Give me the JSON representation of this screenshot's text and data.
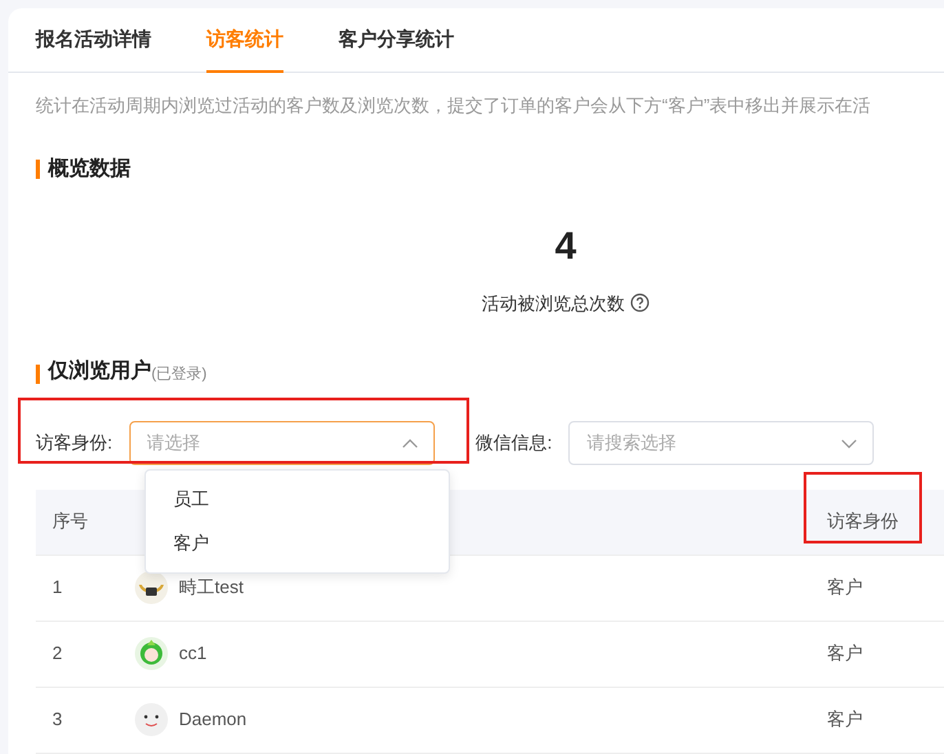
{
  "tabs": [
    {
      "label": "报名活动详情",
      "selected": false
    },
    {
      "label": "访客统计",
      "selected": true
    },
    {
      "label": "客户分享统计",
      "selected": false
    }
  ],
  "description": "统计在活动周期内浏览过活动的客户数及浏览次数，提交了订单的客户会从下方“客户”表中移出并展示在活",
  "overview": {
    "title": "概览数据",
    "value": "4",
    "label": "活动被浏览总次数"
  },
  "users_section": {
    "title": "仅浏览用户",
    "note": "(已登录)"
  },
  "filters": [
    {
      "label": "访客身份:",
      "placeholder": "请选择",
      "expanded": true
    },
    {
      "label": "微信信息:",
      "placeholder": "请搜索选择",
      "expanded": false
    }
  ],
  "dropdown_options": [
    "员工",
    "客户"
  ],
  "table": {
    "columns": [
      "序号",
      "访客身份"
    ],
    "rows": [
      {
        "index": "1",
        "name": "畤工test",
        "identity": "客户"
      },
      {
        "index": "2",
        "name": "cc1",
        "identity": "客户"
      },
      {
        "index": "3",
        "name": "Daemon",
        "identity": "客户"
      }
    ]
  }
}
